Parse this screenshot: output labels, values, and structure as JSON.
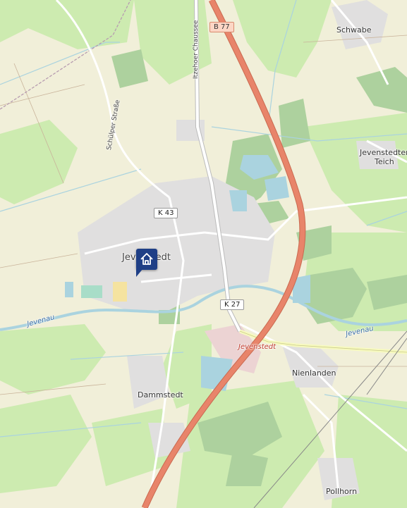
{
  "map": {
    "places": {
      "schwabe": "Schwabe",
      "jevenstedter_teich_1": "Jevenstedter",
      "jevenstedter_teich_2": "Teich",
      "jevenstedt": "Jevenstedt",
      "nienlanden": "Nienlanden",
      "dammstedt": "Dammstedt",
      "pollhorn": "Pollhorn"
    },
    "roads": {
      "b77": "B 77",
      "k43": "K 43",
      "k27": "K 27",
      "itzehoer": "Itzehoer Chaussee",
      "schuelper": "Schülper Straße"
    },
    "water": {
      "jevenau_west": "Jevenau",
      "jevenau_east": "Jevenau"
    },
    "station": "Jevenstedt",
    "marker_icon": "home-icon",
    "colors": {
      "background": "#f1efd9",
      "meadow": "#cdebb0",
      "forest": "#add19e",
      "water": "#aad3df",
      "residential": "#e0dfdf",
      "motorway": "#e8846a",
      "marker": "#1f3f86"
    }
  }
}
